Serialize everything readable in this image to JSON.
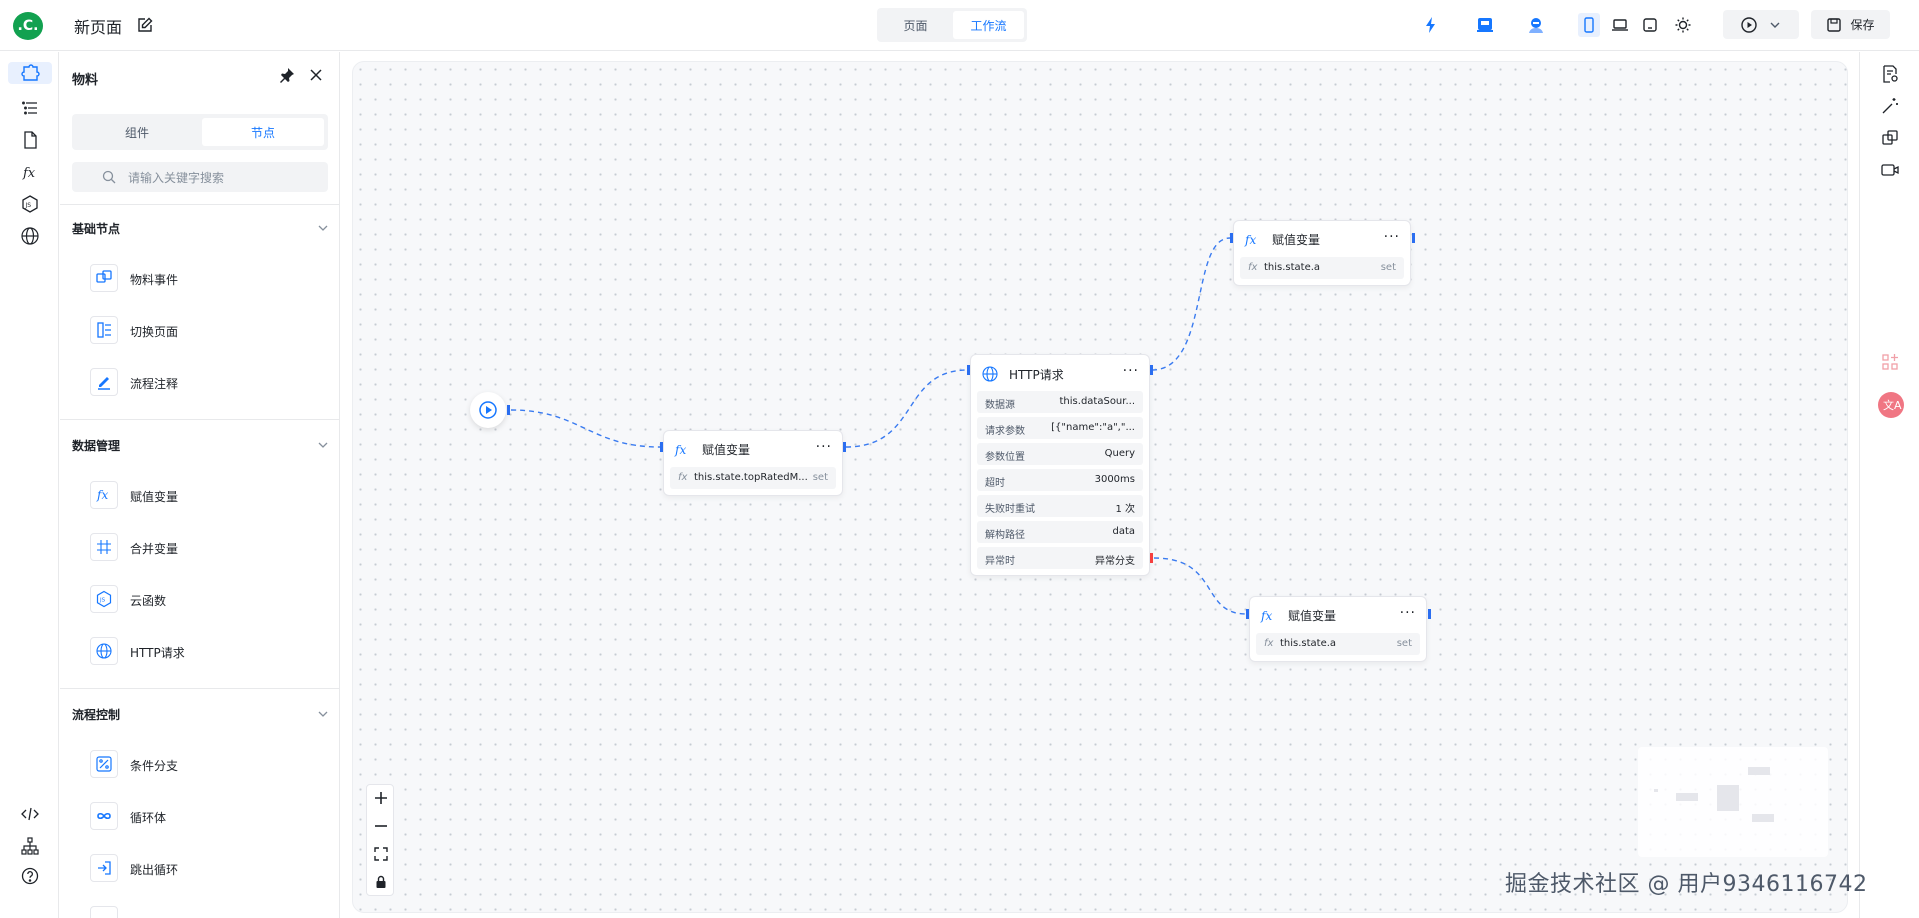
{
  "header": {
    "logo_text": ".C.",
    "page_title": "新页面",
    "tabs": [
      {
        "label": "页面"
      },
      {
        "label": "工作流"
      }
    ],
    "save_label": "保存"
  },
  "panel": {
    "title": "物料",
    "seg_tabs": [
      {
        "label": "组件"
      },
      {
        "label": "节点"
      }
    ],
    "search_placeholder": "请输入关键字搜索",
    "sections": [
      {
        "title": "基础节点",
        "items": [
          {
            "label": "物料事件"
          },
          {
            "label": "切换页面"
          },
          {
            "label": "流程注释"
          }
        ]
      },
      {
        "title": "数据管理",
        "items": [
          {
            "label": "赋值变量"
          },
          {
            "label": "合并变量"
          },
          {
            "label": "云函数"
          },
          {
            "label": "HTTP请求"
          }
        ]
      },
      {
        "title": "流程控制",
        "items": [
          {
            "label": "条件分支"
          },
          {
            "label": "循环体"
          },
          {
            "label": "跳出循环"
          }
        ]
      }
    ]
  },
  "nodes": {
    "assign1": {
      "title": "赋值变量",
      "row_value": "this.state.topRatedM...",
      "row_tag": "set"
    },
    "http": {
      "title": "HTTP请求",
      "rows": [
        {
          "key": "数据源",
          "value": "this.dataSour..."
        },
        {
          "key": "请求参数",
          "value": "[{\"name\":\"a\",\"..."
        },
        {
          "key": "参数位置",
          "value": "Query"
        },
        {
          "key": "超时",
          "value": "3000ms"
        },
        {
          "key": "失败时重试",
          "value": "1 次"
        },
        {
          "key": "解构路径",
          "value": "data"
        },
        {
          "key": "异常时",
          "value": "异常分支"
        }
      ]
    },
    "assign2": {
      "title": "赋值变量",
      "row_value": "this.state.a",
      "row_tag": "set"
    },
    "assign3": {
      "title": "赋值变量",
      "row_value": "this.state.a",
      "row_tag": "set"
    }
  },
  "watermark": "掘金技术社区 @ 用户9346116742",
  "colors": {
    "accent": "#1677ff",
    "port": "#2b6ef0",
    "error_port": "#f53f3f",
    "logo": "#12a150"
  }
}
